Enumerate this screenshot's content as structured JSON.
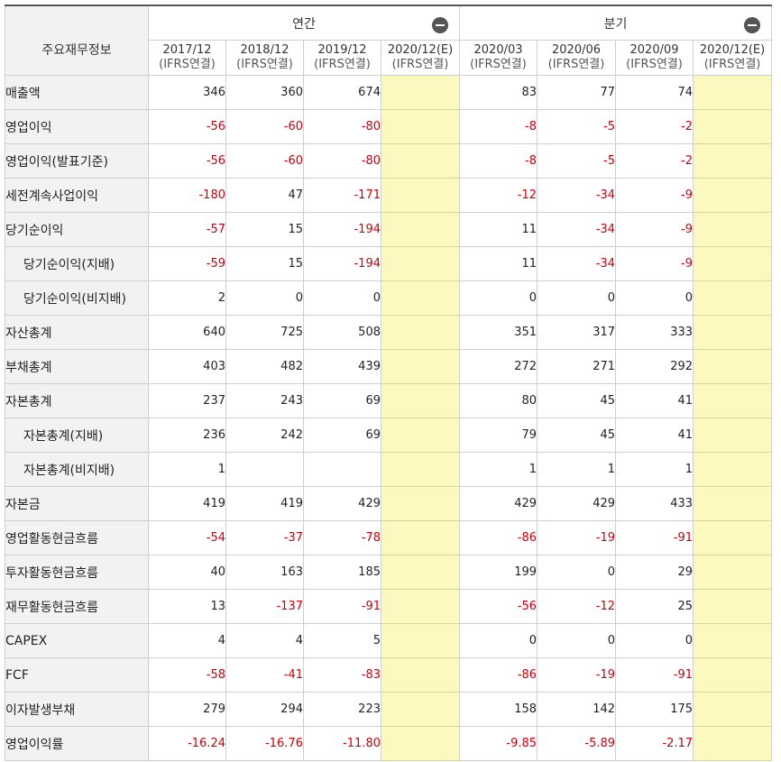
{
  "header": {
    "corner_label": "주요재무정보",
    "groups": [
      {
        "label": "연간"
      },
      {
        "label": "분기"
      }
    ],
    "periods": [
      {
        "date": "2017/12",
        "basis": "(IFRS연결)"
      },
      {
        "date": "2018/12",
        "basis": "(IFRS연결)"
      },
      {
        "date": "2019/12",
        "basis": "(IFRS연결)"
      },
      {
        "date": "2020/12(E)",
        "basis": "(IFRS연결)"
      },
      {
        "date": "2020/03",
        "basis": "(IFRS연결)"
      },
      {
        "date": "2020/06",
        "basis": "(IFRS연결)"
      },
      {
        "date": "2020/09",
        "basis": "(IFRS연결)"
      },
      {
        "date": "2020/12(E)",
        "basis": "(IFRS연결)"
      }
    ]
  },
  "colors": {
    "negative": "#c7000b",
    "estimate_fill": "#fbf8c0",
    "label_fill": "#f2f2f2",
    "collapse_icon": "#555555"
  },
  "icons": {
    "collapse": "minus-circle-icon"
  },
  "rows": [
    {
      "label": "매출액",
      "indent": false,
      "values": [
        "346",
        "360",
        "674",
        "",
        "83",
        "77",
        "74",
        ""
      ]
    },
    {
      "label": "영업이익",
      "indent": false,
      "values": [
        "-56",
        "-60",
        "-80",
        "",
        "-8",
        "-5",
        "-2",
        ""
      ]
    },
    {
      "label": "영업이익(발표기준)",
      "indent": false,
      "values": [
        "-56",
        "-60",
        "-80",
        "",
        "-8",
        "-5",
        "-2",
        ""
      ]
    },
    {
      "label": "세전계속사업이익",
      "indent": false,
      "values": [
        "-180",
        "47",
        "-171",
        "",
        "-12",
        "-34",
        "-9",
        ""
      ]
    },
    {
      "label": "당기순이익",
      "indent": false,
      "values": [
        "-57",
        "15",
        "-194",
        "",
        "11",
        "-34",
        "-9",
        ""
      ]
    },
    {
      "label": "당기순이익(지배)",
      "indent": true,
      "values": [
        "-59",
        "15",
        "-194",
        "",
        "11",
        "-34",
        "-9",
        ""
      ]
    },
    {
      "label": "당기순이익(비지배)",
      "indent": true,
      "values": [
        "2",
        "0",
        "0",
        "",
        "0",
        "0",
        "0",
        ""
      ]
    },
    {
      "label": "자산총계",
      "indent": false,
      "values": [
        "640",
        "725",
        "508",
        "",
        "351",
        "317",
        "333",
        ""
      ]
    },
    {
      "label": "부채총계",
      "indent": false,
      "values": [
        "403",
        "482",
        "439",
        "",
        "272",
        "271",
        "292",
        ""
      ]
    },
    {
      "label": "자본총계",
      "indent": false,
      "values": [
        "237",
        "243",
        "69",
        "",
        "80",
        "45",
        "41",
        ""
      ]
    },
    {
      "label": "자본총계(지배)",
      "indent": true,
      "values": [
        "236",
        "242",
        "69",
        "",
        "79",
        "45",
        "41",
        ""
      ]
    },
    {
      "label": "자본총계(비지배)",
      "indent": true,
      "values": [
        "1",
        "",
        "",
        "",
        "1",
        "1",
        "1",
        ""
      ]
    },
    {
      "label": "자본금",
      "indent": false,
      "values": [
        "419",
        "419",
        "429",
        "",
        "429",
        "429",
        "433",
        ""
      ]
    },
    {
      "label": "영업활동현금흐름",
      "indent": false,
      "values": [
        "-54",
        "-37",
        "-78",
        "",
        "-86",
        "-19",
        "-91",
        ""
      ]
    },
    {
      "label": "투자활동현금흐름",
      "indent": false,
      "values": [
        "40",
        "163",
        "185",
        "",
        "199",
        "0",
        "29",
        ""
      ]
    },
    {
      "label": "재무활동현금흐름",
      "indent": false,
      "values": [
        "13",
        "-137",
        "-91",
        "",
        "-56",
        "-12",
        "25",
        ""
      ]
    },
    {
      "label": "CAPEX",
      "indent": false,
      "values": [
        "4",
        "4",
        "5",
        "",
        "0",
        "0",
        "0",
        ""
      ]
    },
    {
      "label": "FCF",
      "indent": false,
      "values": [
        "-58",
        "-41",
        "-83",
        "",
        "-86",
        "-19",
        "-91",
        ""
      ]
    },
    {
      "label": "이자발생부채",
      "indent": false,
      "values": [
        "279",
        "294",
        "223",
        "",
        "158",
        "142",
        "175",
        ""
      ]
    },
    {
      "label": "영업이익률",
      "indent": false,
      "values": [
        "-16.24",
        "-16.76",
        "-11.80",
        "",
        "-9.85",
        "-5.89",
        "-2.17",
        ""
      ]
    }
  ]
}
